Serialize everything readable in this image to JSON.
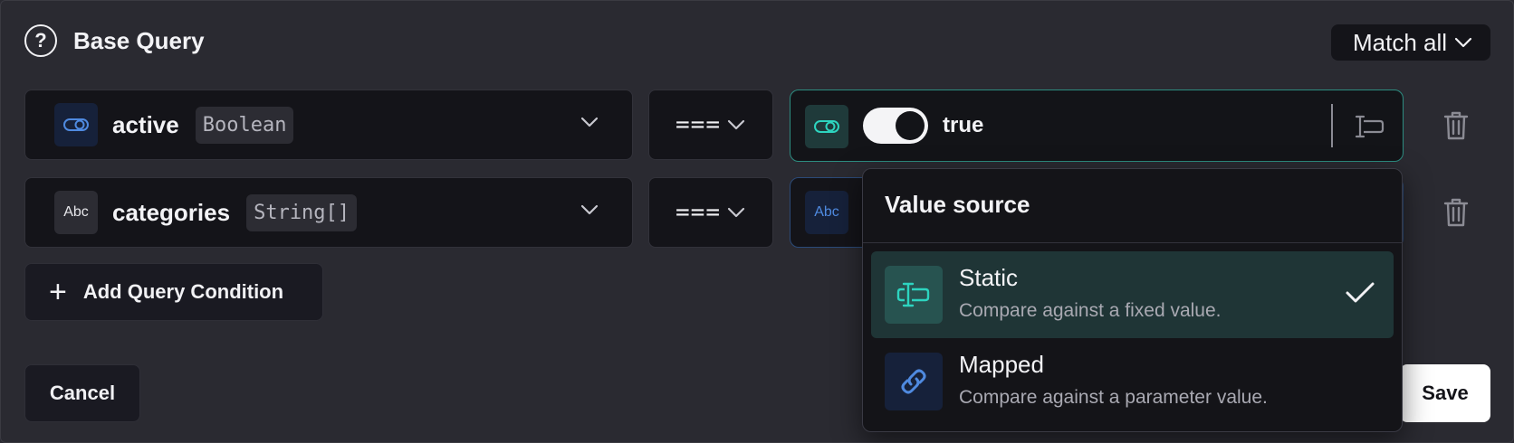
{
  "header": {
    "title": "Base Query",
    "match_mode": "Match all"
  },
  "conditions": [
    {
      "field": "active",
      "type": "Boolean",
      "type_icon_text": "",
      "operator": "===",
      "value": "true"
    },
    {
      "field": "categories",
      "type": "String[]",
      "type_icon_text": "Abc",
      "operator": "===",
      "value_icon_text": "Abc"
    }
  ],
  "actions": {
    "add_condition": "Add Query Condition",
    "cancel": "Cancel",
    "save": "Save"
  },
  "value_source_menu": {
    "title": "Value source",
    "options": [
      {
        "label": "Static",
        "description": "Compare against a fixed value.",
        "selected": true,
        "icon": "text-cursor-icon"
      },
      {
        "label": "Mapped",
        "description": "Compare against a parameter value.",
        "selected": false,
        "icon": "link-icon"
      }
    ]
  },
  "colors": {
    "accent_teal": "#2dd4bf",
    "accent_blue": "#4f8ae0",
    "background": "#2a2a31",
    "panel": "#141419"
  }
}
